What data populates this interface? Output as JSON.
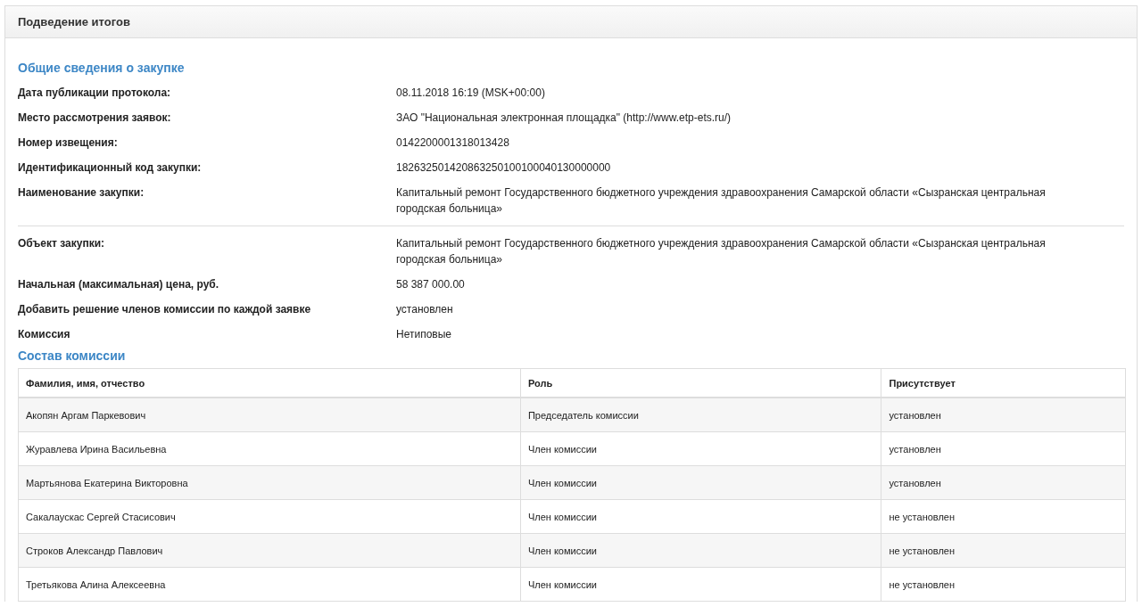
{
  "panel": {
    "title": "Подведение итогов"
  },
  "procurement": {
    "title": "Общие сведения о закупке",
    "fields": [
      {
        "label": "Дата публикации протокола:",
        "value": "08.11.2018 16:19 (MSK+00:00)"
      },
      {
        "label": "Место рассмотрения заявок:",
        "value": "ЗАО \"Национальная электронная площадка\" (http://www.etp-ets.ru/)"
      },
      {
        "label": "Номер извещения:",
        "value": "0142200001318013428"
      },
      {
        "label": "Идентификационный код закупки:",
        "value": "182632501420863250100100040130000000"
      },
      {
        "label": "Наименование закупки:",
        "value": "Капитальный ремонт Государственного бюджетного учреждения здравоохранения Самарской области «Сызранская центральная городская больница»"
      }
    ],
    "details": [
      {
        "label": "Объект закупки:",
        "value": "Капитальный ремонт Государственного бюджетного учреждения здравоохранения Самарской области «Сызранская центральная городская больница»"
      },
      {
        "label": "Начальная (максимальная) цена, руб.",
        "value": "58 387 000.00"
      },
      {
        "label": "Добавить решение членов комиссии по каждой заявке",
        "value": "установлен"
      },
      {
        "label": "Комиссия",
        "value": "Нетиповые"
      }
    ]
  },
  "commission": {
    "title": "Состав комиссии",
    "columns": [
      "Фамилия, имя, отчество",
      "Роль",
      "Присутствует"
    ],
    "rows": [
      [
        "Акопян Аргам Паркевович",
        "Председатель комиссии",
        "установлен"
      ],
      [
        "Журавлева Ирина Васильевна",
        "Член комиссии",
        "установлен"
      ],
      [
        "Мартьянова Екатерина Викторовна",
        "Член комиссии",
        "установлен"
      ],
      [
        "Сакалаускас Сергей Стасисович",
        "Член комиссии",
        "не установлен"
      ],
      [
        "Строков Александр Павлович",
        "Член комиссии",
        "не установлен"
      ],
      [
        "Третьякова Алина Алексеевна",
        "Член комиссии",
        "не установлен"
      ]
    ]
  }
}
